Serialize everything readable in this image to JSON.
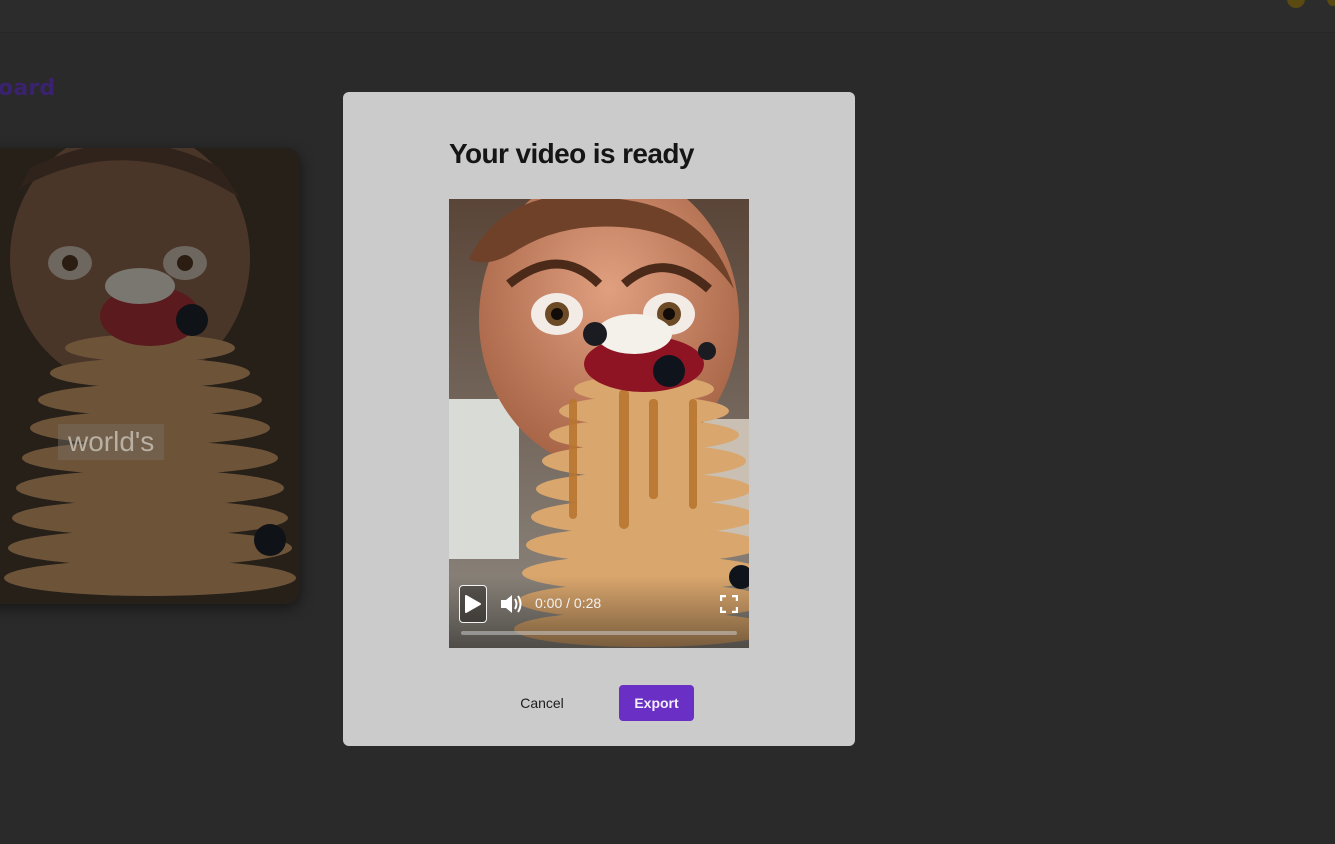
{
  "background": {
    "page_title_fragment": "oard",
    "card_caption": "world's"
  },
  "modal": {
    "title": "Your video is ready",
    "video": {
      "time_display": "0:00 / 0:28",
      "progress": 0.0,
      "play_icon": "play-icon",
      "volume_icon": "volume-icon",
      "fullscreen_icon": "fullscreen-icon"
    },
    "cancel_label": "Cancel",
    "export_label": "Export"
  },
  "colors": {
    "overlay_bg": "#2a2a2a",
    "modal_bg": "#cbcbcb",
    "accent": "#6a2fc4"
  }
}
